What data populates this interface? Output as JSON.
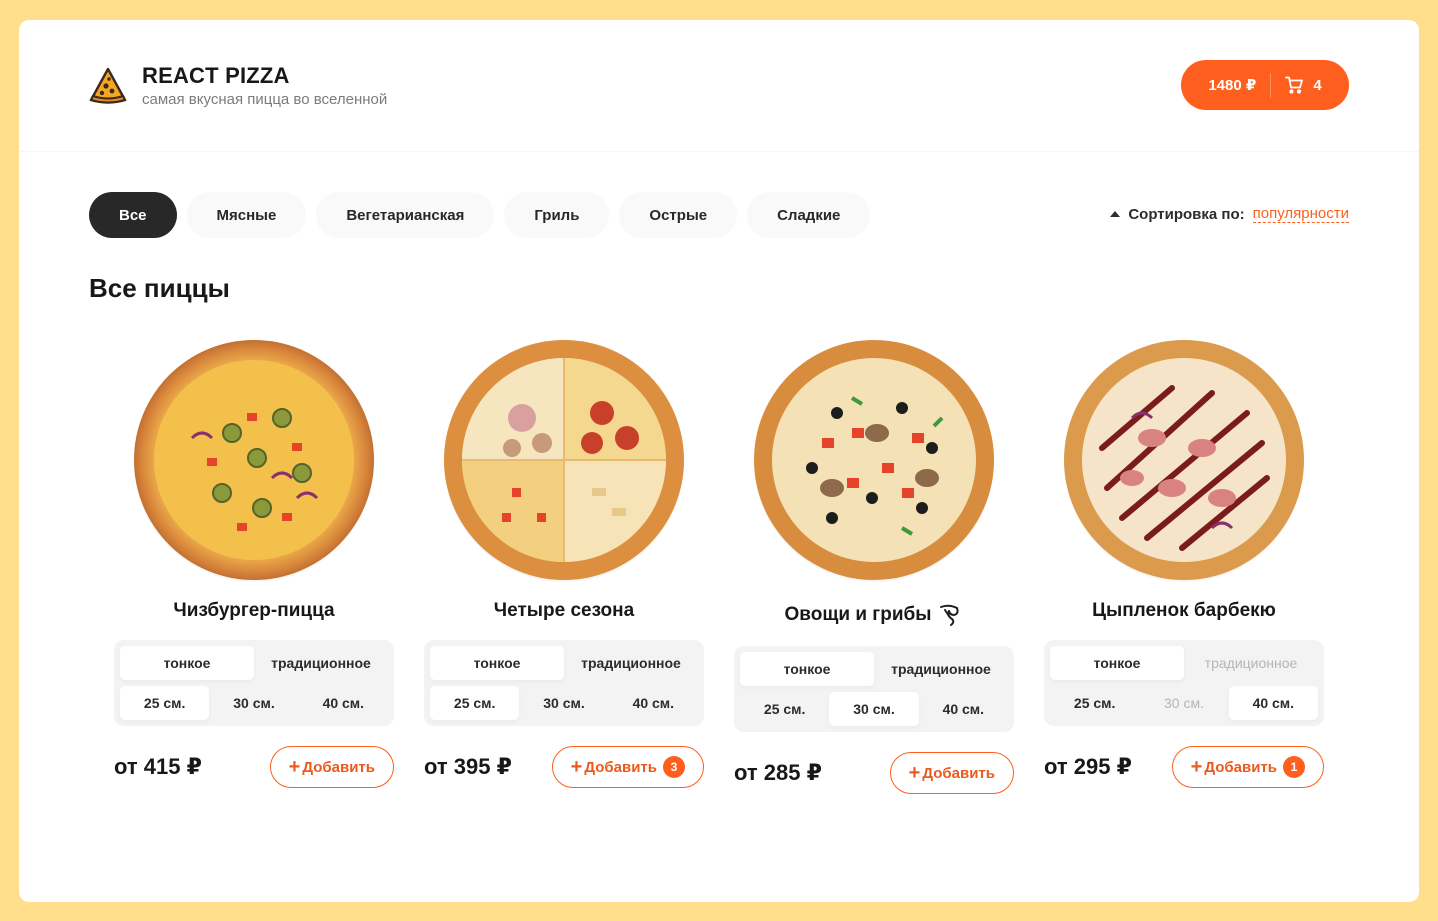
{
  "header": {
    "logo_title": "REACT PIZZA",
    "logo_subtitle": "самая вкусная пицца во вселенной",
    "cart_total": "1480 ₽",
    "cart_count": "4"
  },
  "categories": [
    "Все",
    "Мясные",
    "Вегетарианская",
    "Гриль",
    "Острые",
    "Сладкие"
  ],
  "active_category": "Все",
  "sort": {
    "label": "Сортировка по:",
    "value": "популярности"
  },
  "section_title": "Все пиццы",
  "colors": {
    "accent": "#fe5f1e",
    "background": "#ffdf8c",
    "dark": "#282828"
  },
  "pizzas": [
    {
      "name": "Чизбургер-пицца",
      "dough": [
        "тонкое",
        "традиционное"
      ],
      "dough_active": "тонкое",
      "sizes": [
        "25 см.",
        "30 см.",
        "40 см."
      ],
      "size_active": "25 см.",
      "price": "от 415 ₽",
      "add_label": "Добавить",
      "count": ""
    },
    {
      "name": "Четыре сезона",
      "dough": [
        "тонкое",
        "традиционное"
      ],
      "dough_active": "тонкое",
      "sizes": [
        "25 см.",
        "30 см.",
        "40 см."
      ],
      "size_active": "25 см.",
      "price": "от 395 ₽",
      "add_label": "Добавить",
      "count": "3"
    },
    {
      "name": "Овощи и грибы",
      "dough": [
        "тонкое",
        "традиционное"
      ],
      "dough_active": "тонкое",
      "sizes": [
        "25 см.",
        "30 см.",
        "40 см."
      ],
      "size_active": "30 см.",
      "price": "от 285 ₽",
      "add_label": "Добавить",
      "count": "",
      "icon": "leaf-icon"
    },
    {
      "name": "Цыпленок барбекю",
      "dough": [
        "тонкое",
        "традиционное"
      ],
      "dough_active": "тонкое",
      "dough_disabled": "традиционное",
      "sizes": [
        "25 см.",
        "30 см.",
        "40 см."
      ],
      "size_active": "40 см.",
      "size_disabled": "30 см.",
      "price": "от 295 ₽",
      "add_label": "Добавить",
      "count": "1"
    }
  ]
}
